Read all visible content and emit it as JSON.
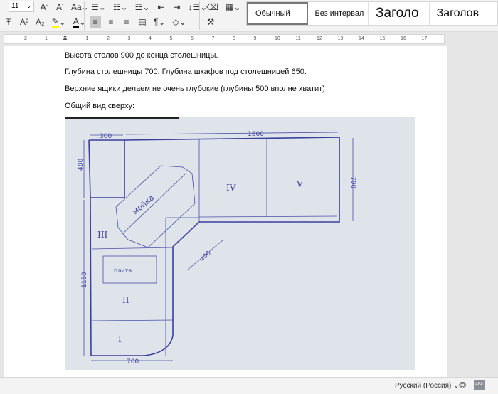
{
  "toolbar": {
    "font_size": "11",
    "styles": [
      {
        "label": "Обычный",
        "selected": true
      },
      {
        "label": "Без интервал"
      },
      {
        "label": "Заголо"
      },
      {
        "label": "Заголов"
      }
    ],
    "highlight_color": "#ffff00",
    "font_color": "#000000"
  },
  "ruler": {
    "labels": [
      "2",
      "1",
      "1",
      "2",
      "3",
      "4",
      "5",
      "6",
      "7",
      "8",
      "9",
      "10",
      "11",
      "12",
      "13",
      "14",
      "15",
      "16",
      "17"
    ]
  },
  "document": {
    "paragraphs": [
      "Высота столов 900 до конца столешницы.",
      "Глубина столешницы 700. Глубина шкафов под столешницей 650.",
      "Верхние ящики делаем не очень глубокие (глубины 500 вполне хватит)",
      "Общий вид сверху:"
    ],
    "sketch": {
      "dimensions": {
        "top_left": "300",
        "top": "1800",
        "left_top": "480",
        "right": "700",
        "left": "1150",
        "bottom": "700",
        "diagonal": "400"
      },
      "sink_label": "мойка",
      "stove_label": "плита",
      "sections": [
        "I",
        "II",
        "III",
        "IV",
        "V"
      ],
      "ink_color": "#3a3f9e"
    }
  },
  "status": {
    "language": "Русский (Россия)"
  }
}
